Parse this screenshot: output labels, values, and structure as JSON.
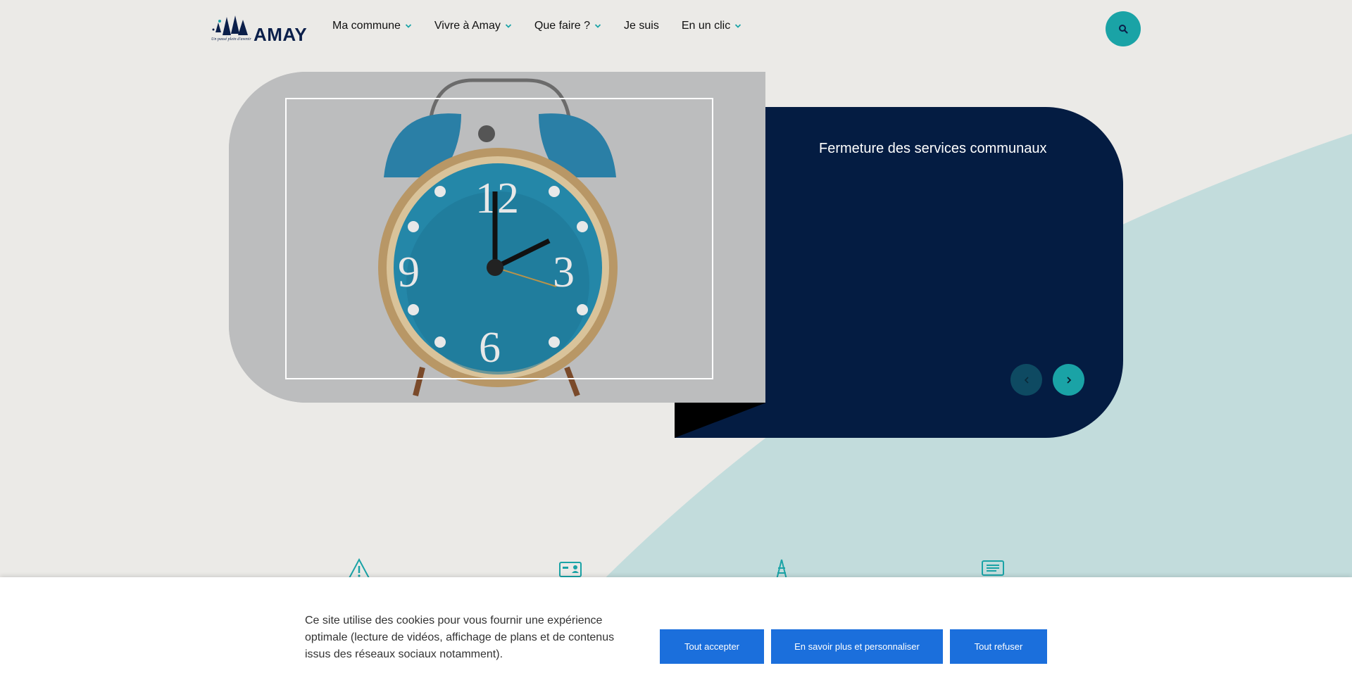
{
  "header": {
    "logo_text": "AMAY",
    "logo_tagline": "Un passé plein d'avenir",
    "nav": [
      {
        "label": "Ma commune",
        "has_dropdown": true
      },
      {
        "label": "Vivre à Amay",
        "has_dropdown": true
      },
      {
        "label": "Que faire ?",
        "has_dropdown": true
      },
      {
        "label": "Je suis",
        "has_dropdown": false
      },
      {
        "label": "En un clic",
        "has_dropdown": true
      }
    ],
    "search_icon": "search-icon"
  },
  "hero": {
    "title": "Fermeture des services communaux",
    "image": "alarm-clock-photo",
    "prev_icon": "chevron-left-icon",
    "next_icon": "chevron-right-icon"
  },
  "quick_icons": [
    "warning-icon",
    "id-card-icon",
    "tower-icon",
    "screen-icon"
  ],
  "cookie_banner": {
    "text": "Ce site utilise des cookies pour vous fournir une expérience optimale (lecture de vidéos, affichage de plans et de contenus issus des réseaux sociaux notamment).",
    "accept_label": "Tout accepter",
    "customize_label": "En savoir plus et personnaliser",
    "refuse_label": "Tout refuser"
  },
  "colors": {
    "accent": "#1aa3a6",
    "navy": "#041c42",
    "background": "#ebeae7",
    "swoosh": "#c2dcdc",
    "button_blue": "#1b6fdc"
  }
}
